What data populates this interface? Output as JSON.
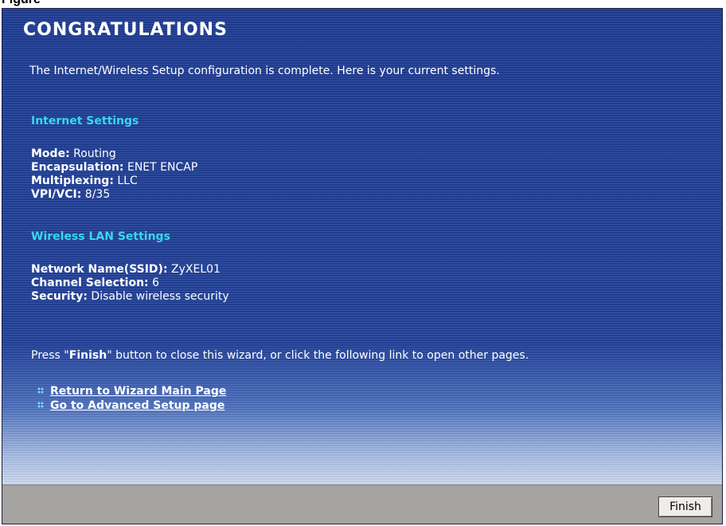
{
  "caption_fragment": "Figure",
  "wizard": {
    "title": "CONGRATULATIONS",
    "intro": "The Internet/Wireless Setup configuration is complete. Here is your current settings.",
    "internet": {
      "heading": "Internet Settings",
      "rows": [
        {
          "label": "Mode:",
          "value": "Routing"
        },
        {
          "label": "Encapsulation:",
          "value": "ENET ENCAP"
        },
        {
          "label": "Multiplexing:",
          "value": "LLC"
        },
        {
          "label": "VPI/VCI:",
          "value": "8/35"
        }
      ]
    },
    "wireless": {
      "heading": "Wireless LAN Settings",
      "rows": [
        {
          "label": "Network Name(SSID):",
          "value": "ZyXEL01"
        },
        {
          "label": "Channel Selection:",
          "value": "6"
        },
        {
          "label": "Security:",
          "value": "Disable wireless security"
        }
      ]
    },
    "press_text": {
      "before": "Press \"",
      "strong": "Finish",
      "after": "\" button to close this wizard, or click the following link to open other pages."
    },
    "links": [
      {
        "label": "Return to Wizard Main Page",
        "icon": "grip-dots-icon"
      },
      {
        "label": "Go to Advanced Setup page",
        "icon": "grip-dots-icon"
      }
    ],
    "finish_label": "Finish"
  },
  "colors": {
    "panel_blue": "#23439c",
    "heading_cyan": "#39d7ee",
    "button_bar_gray": "#a6a4a1"
  }
}
